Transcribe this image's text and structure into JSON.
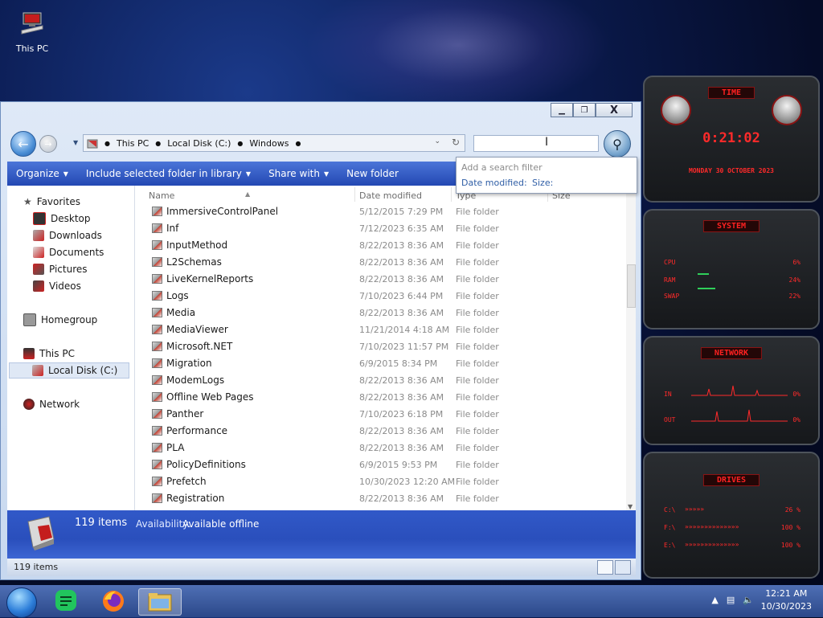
{
  "desktop": {
    "icon_label": "This PC"
  },
  "window": {
    "controls": {
      "minimize": "▁",
      "maximize": "❐",
      "close": "X"
    },
    "address": {
      "crumbs": [
        "This PC",
        "Local Disk (C:)",
        "Windows"
      ]
    },
    "toolbar": {
      "organize": "Organize",
      "include": "Include selected folder in library",
      "share": "Share with",
      "new_folder": "New folder"
    },
    "search_popup": {
      "hint": "Add a search filter",
      "date_modified": "Date modified:",
      "size": "Size:"
    },
    "sidebar": {
      "favorites": "Favorites",
      "desktop": "Desktop",
      "downloads": "Downloads",
      "documents": "Documents",
      "pictures": "Pictures",
      "videos": "Videos",
      "homegroup": "Homegroup",
      "this_pc": "This PC",
      "local_disk": "Local Disk (C:)",
      "network": "Network"
    },
    "columns": {
      "name": "Name",
      "date": "Date modified",
      "type": "Type",
      "size": "Size"
    },
    "files": [
      {
        "name": "ImmersiveControlPanel",
        "date": "5/12/2015 7:29 PM",
        "type": "File folder"
      },
      {
        "name": "Inf",
        "date": "7/12/2023 6:35 AM",
        "type": "File folder"
      },
      {
        "name": "InputMethod",
        "date": "8/22/2013 8:36 AM",
        "type": "File folder"
      },
      {
        "name": "L2Schemas",
        "date": "8/22/2013 8:36 AM",
        "type": "File folder"
      },
      {
        "name": "LiveKernelReports",
        "date": "8/22/2013 8:36 AM",
        "type": "File folder"
      },
      {
        "name": "Logs",
        "date": "7/10/2023 6:44 PM",
        "type": "File folder"
      },
      {
        "name": "Media",
        "date": "8/22/2013 8:36 AM",
        "type": "File folder"
      },
      {
        "name": "MediaViewer",
        "date": "11/21/2014 4:18 AM",
        "type": "File folder"
      },
      {
        "name": "Microsoft.NET",
        "date": "7/10/2023 11:57 PM",
        "type": "File folder"
      },
      {
        "name": "Migration",
        "date": "6/9/2015 8:34 PM",
        "type": "File folder"
      },
      {
        "name": "ModemLogs",
        "date": "8/22/2013 8:36 AM",
        "type": "File folder"
      },
      {
        "name": "Offline Web Pages",
        "date": "8/22/2013 8:36 AM",
        "type": "File folder"
      },
      {
        "name": "Panther",
        "date": "7/10/2023 6:18 PM",
        "type": "File folder"
      },
      {
        "name": "Performance",
        "date": "8/22/2013 8:36 AM",
        "type": "File folder"
      },
      {
        "name": "PLA",
        "date": "8/22/2013 8:36 AM",
        "type": "File folder"
      },
      {
        "name": "PolicyDefinitions",
        "date": "6/9/2015 9:53 PM",
        "type": "File folder"
      },
      {
        "name": "Prefetch",
        "date": "10/30/2023 12:20 AM",
        "type": "File folder"
      },
      {
        "name": "Registration",
        "date": "8/22/2013 8:36 AM",
        "type": "File folder"
      }
    ],
    "details": {
      "count": "119 items",
      "availability_label": "Availability:",
      "availability_value": "Available offline"
    },
    "status": {
      "count": "119 items"
    }
  },
  "gadgets": {
    "time": {
      "title": "TIME",
      "clock": "0:21:02",
      "date": "MONDAY 30 OCTOBER 2023"
    },
    "system": {
      "title": "SYSTEM",
      "cpu_label": "CPU",
      "cpu_value": "6%",
      "ram_label": "RAM",
      "ram_value": "24%",
      "swap_label": "SWAP",
      "swap_value": "22%"
    },
    "network": {
      "title": "NETWORK",
      "in_label": "IN",
      "in_value": "0%",
      "out_label": "OUT",
      "out_value": "0%"
    },
    "drives": {
      "title": "DRIVES",
      "c_label": "C:\\",
      "c_value": "26 %",
      "f_label": "F:\\",
      "f_value": "100 %",
      "e_label": "E:\\",
      "e_value": "100 %"
    }
  },
  "taskbar": {
    "time": "12:21 AM",
    "date": "10/30/2023"
  },
  "colors": {
    "accent_blue": "#2348b3",
    "gadget_red": "#ff2a2a",
    "window_frame": "#c7d8ef"
  }
}
